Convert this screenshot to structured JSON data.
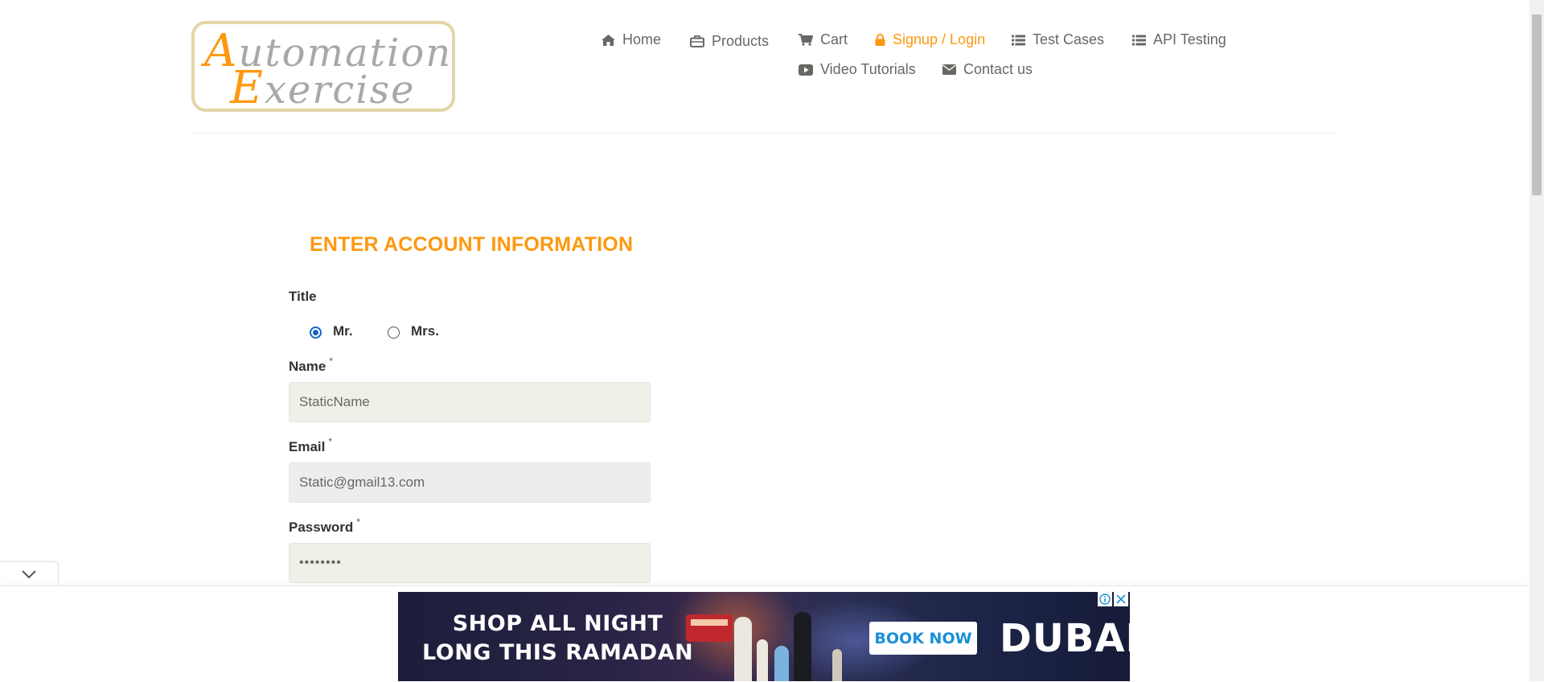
{
  "logo": {
    "line1_cap": "A",
    "line1_rest": "utomation",
    "line2_cap": "E",
    "line2_rest": "xercise"
  },
  "nav": [
    {
      "label": "Home",
      "icon": "home-icon"
    },
    {
      "label": "Products",
      "icon": "briefcase-icon"
    },
    {
      "label": "Cart",
      "icon": "cart-icon"
    },
    {
      "label": "Signup / Login",
      "icon": "lock-icon",
      "active": true
    },
    {
      "label": "Test Cases",
      "icon": "list-icon"
    },
    {
      "label": "API Testing",
      "icon": "list-icon"
    },
    {
      "label": "Video Tutorials",
      "icon": "youtube-play-icon"
    },
    {
      "label": "Contact us",
      "icon": "envelope-icon"
    }
  ],
  "form": {
    "heading": "ENTER ACCOUNT INFORMATION",
    "title_label": "Title",
    "title_options": [
      "Mr.",
      "Mrs."
    ],
    "title_selected": "Mr.",
    "required_mark": "*",
    "name_label": "Name",
    "name_value": "StaticName",
    "email_label": "Email",
    "email_value": "Static@gmail13.com",
    "password_label": "Password",
    "password_value": "••••••••"
  },
  "ad": {
    "headline_line1": "SHOP ALL NIGHT",
    "headline_line2": "LONG THIS RAMADAN",
    "cta": "BOOK NOW",
    "brand": "DUBAI"
  },
  "colors": {
    "accent": "#fe980f",
    "text": "#696763",
    "radio_checked": "#1464c8"
  }
}
